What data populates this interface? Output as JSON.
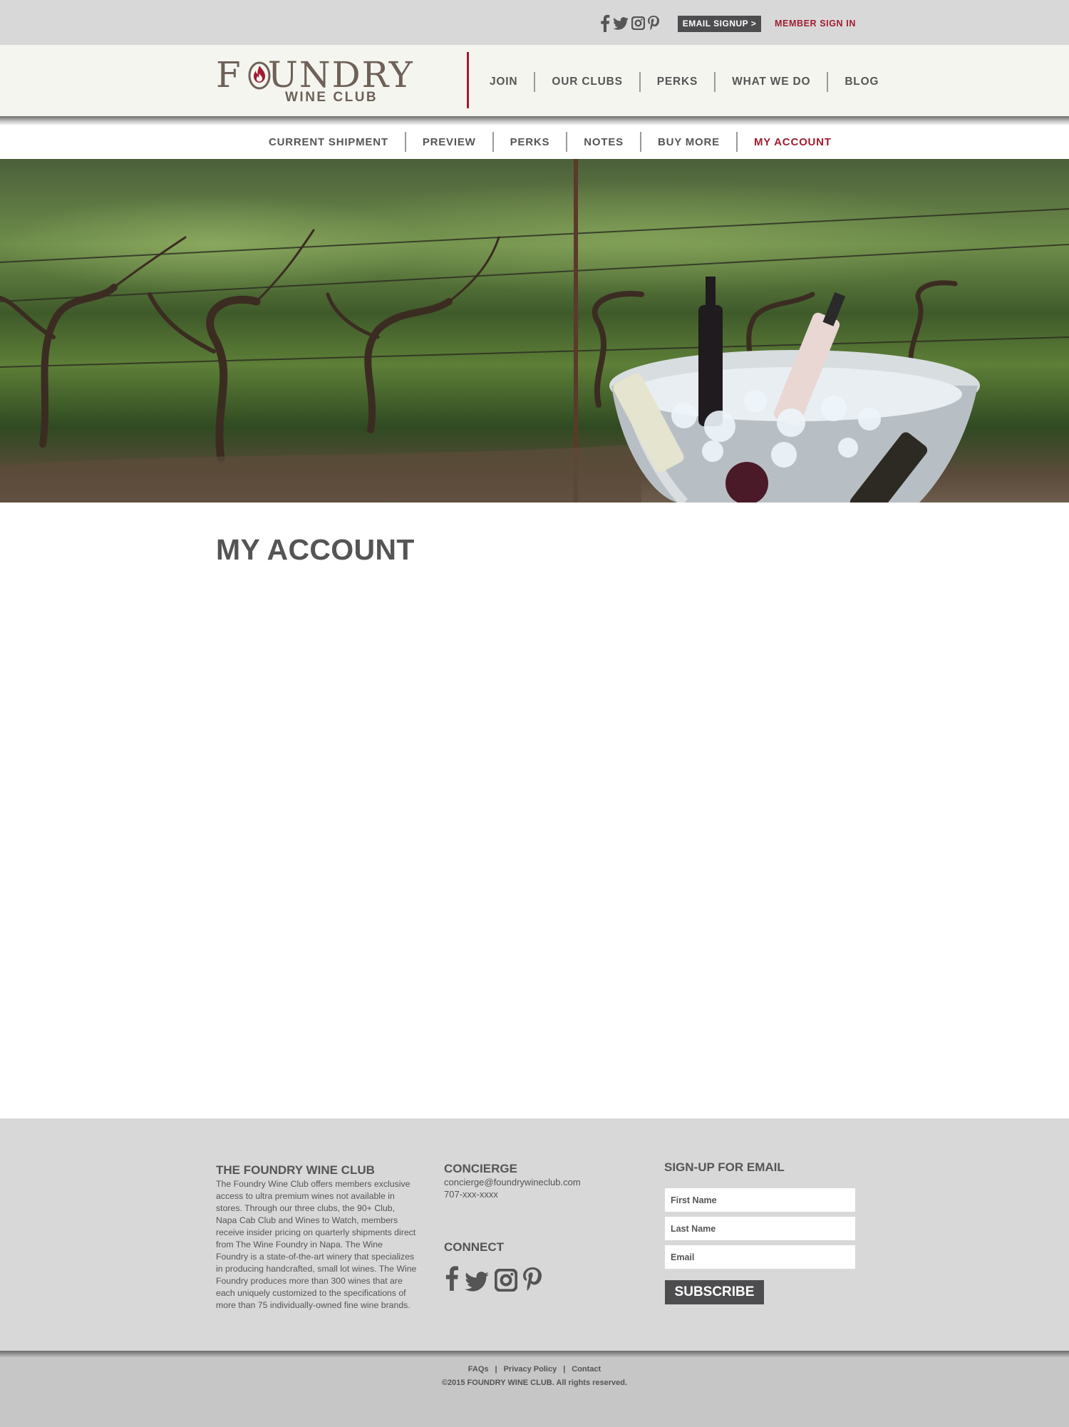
{
  "topbar": {
    "social_icons": [
      "facebook-icon",
      "twitter-icon",
      "instagram-icon",
      "pinterest-icon"
    ],
    "email_signup_label": "EMAIL SIGNUP >",
    "member_signin_label": "MEMBER SIGN IN"
  },
  "logo": {
    "name": "FOUNDRY",
    "sub": "WINE CLUB"
  },
  "main_nav": {
    "items": [
      {
        "label": "JOIN"
      },
      {
        "label": "OUR CLUBS"
      },
      {
        "label": "PERKS"
      },
      {
        "label": "WHAT WE DO"
      },
      {
        "label": "BLOG"
      }
    ]
  },
  "sub_nav": {
    "active": "MY ACCOUNT",
    "items": [
      {
        "label": "CURRENT SHIPMENT"
      },
      {
        "label": "PREVIEW"
      },
      {
        "label": "PERKS"
      },
      {
        "label": "NOTES"
      },
      {
        "label": "BUY MORE"
      },
      {
        "label": "MY ACCOUNT"
      }
    ]
  },
  "main": {
    "page_title": "MY ACCOUNT"
  },
  "footer": {
    "about_title": "THE FOUNDRY WINE CLUB",
    "about_text": "The Foundry Wine Club offers members exclusive access to ultra premium wines not available in stores.  Through our three clubs, the 90+ Club, Napa Cab Club and Wines to Watch, members receive insider pricing on quarterly shipments direct from The Wine Foundry in Napa.  The Wine Foundry is a state-of-the-art winery that specializes in producing handcrafted, small lot wines.  The Wine Foundry produces more than 300 wines that are each uniquely customized to the specifications of more than 75 individually-owned fine wine brands.",
    "concierge_title": "CONCIERGE",
    "concierge_email": "concierge@foundrywineclub.com",
    "concierge_phone": "707-xxx-xxxx",
    "connect_title": "CONNECT",
    "signup_title": "SIGN-UP FOR EMAIL",
    "first_name_placeholder": "First Name",
    "last_name_placeholder": "Last Name",
    "email_placeholder": "Email",
    "subscribe_label": "SUBSCRIBE"
  },
  "legal": {
    "faqs": "FAQs",
    "privacy": "Privacy Policy",
    "contact": "Contact",
    "separator": "|",
    "copyright": "©2015 FOUNDRY WINE CLUB.  All rights reserved."
  },
  "colors": {
    "accent": "#a01c30",
    "text": "#555555",
    "dark_button": "#4d4d4f",
    "topbar_bg": "#d9d8d9",
    "header_bg": "#f5f5f0"
  }
}
